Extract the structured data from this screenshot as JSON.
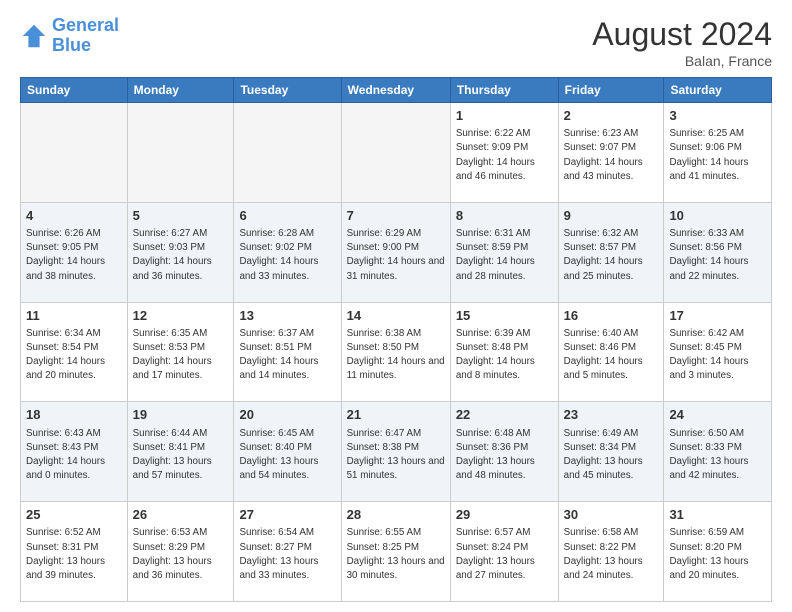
{
  "logo": {
    "line1": "General",
    "line2": "Blue"
  },
  "header": {
    "month": "August 2024",
    "location": "Balan, France"
  },
  "days_of_week": [
    "Sunday",
    "Monday",
    "Tuesday",
    "Wednesday",
    "Thursday",
    "Friday",
    "Saturday"
  ],
  "weeks": [
    [
      {
        "day": "",
        "info": ""
      },
      {
        "day": "",
        "info": ""
      },
      {
        "day": "",
        "info": ""
      },
      {
        "day": "",
        "info": ""
      },
      {
        "day": "1",
        "info": "Sunrise: 6:22 AM\nSunset: 9:09 PM\nDaylight: 14 hours\nand 46 minutes."
      },
      {
        "day": "2",
        "info": "Sunrise: 6:23 AM\nSunset: 9:07 PM\nDaylight: 14 hours\nand 43 minutes."
      },
      {
        "day": "3",
        "info": "Sunrise: 6:25 AM\nSunset: 9:06 PM\nDaylight: 14 hours\nand 41 minutes."
      }
    ],
    [
      {
        "day": "4",
        "info": "Sunrise: 6:26 AM\nSunset: 9:05 PM\nDaylight: 14 hours\nand 38 minutes."
      },
      {
        "day": "5",
        "info": "Sunrise: 6:27 AM\nSunset: 9:03 PM\nDaylight: 14 hours\nand 36 minutes."
      },
      {
        "day": "6",
        "info": "Sunrise: 6:28 AM\nSunset: 9:02 PM\nDaylight: 14 hours\nand 33 minutes."
      },
      {
        "day": "7",
        "info": "Sunrise: 6:29 AM\nSunset: 9:00 PM\nDaylight: 14 hours\nand 31 minutes."
      },
      {
        "day": "8",
        "info": "Sunrise: 6:31 AM\nSunset: 8:59 PM\nDaylight: 14 hours\nand 28 minutes."
      },
      {
        "day": "9",
        "info": "Sunrise: 6:32 AM\nSunset: 8:57 PM\nDaylight: 14 hours\nand 25 minutes."
      },
      {
        "day": "10",
        "info": "Sunrise: 6:33 AM\nSunset: 8:56 PM\nDaylight: 14 hours\nand 22 minutes."
      }
    ],
    [
      {
        "day": "11",
        "info": "Sunrise: 6:34 AM\nSunset: 8:54 PM\nDaylight: 14 hours\nand 20 minutes."
      },
      {
        "day": "12",
        "info": "Sunrise: 6:35 AM\nSunset: 8:53 PM\nDaylight: 14 hours\nand 17 minutes."
      },
      {
        "day": "13",
        "info": "Sunrise: 6:37 AM\nSunset: 8:51 PM\nDaylight: 14 hours\nand 14 minutes."
      },
      {
        "day": "14",
        "info": "Sunrise: 6:38 AM\nSunset: 8:50 PM\nDaylight: 14 hours\nand 11 minutes."
      },
      {
        "day": "15",
        "info": "Sunrise: 6:39 AM\nSunset: 8:48 PM\nDaylight: 14 hours\nand 8 minutes."
      },
      {
        "day": "16",
        "info": "Sunrise: 6:40 AM\nSunset: 8:46 PM\nDaylight: 14 hours\nand 5 minutes."
      },
      {
        "day": "17",
        "info": "Sunrise: 6:42 AM\nSunset: 8:45 PM\nDaylight: 14 hours\nand 3 minutes."
      }
    ],
    [
      {
        "day": "18",
        "info": "Sunrise: 6:43 AM\nSunset: 8:43 PM\nDaylight: 14 hours\nand 0 minutes."
      },
      {
        "day": "19",
        "info": "Sunrise: 6:44 AM\nSunset: 8:41 PM\nDaylight: 13 hours\nand 57 minutes."
      },
      {
        "day": "20",
        "info": "Sunrise: 6:45 AM\nSunset: 8:40 PM\nDaylight: 13 hours\nand 54 minutes."
      },
      {
        "day": "21",
        "info": "Sunrise: 6:47 AM\nSunset: 8:38 PM\nDaylight: 13 hours\nand 51 minutes."
      },
      {
        "day": "22",
        "info": "Sunrise: 6:48 AM\nSunset: 8:36 PM\nDaylight: 13 hours\nand 48 minutes."
      },
      {
        "day": "23",
        "info": "Sunrise: 6:49 AM\nSunset: 8:34 PM\nDaylight: 13 hours\nand 45 minutes."
      },
      {
        "day": "24",
        "info": "Sunrise: 6:50 AM\nSunset: 8:33 PM\nDaylight: 13 hours\nand 42 minutes."
      }
    ],
    [
      {
        "day": "25",
        "info": "Sunrise: 6:52 AM\nSunset: 8:31 PM\nDaylight: 13 hours\nand 39 minutes."
      },
      {
        "day": "26",
        "info": "Sunrise: 6:53 AM\nSunset: 8:29 PM\nDaylight: 13 hours\nand 36 minutes."
      },
      {
        "day": "27",
        "info": "Sunrise: 6:54 AM\nSunset: 8:27 PM\nDaylight: 13 hours\nand 33 minutes."
      },
      {
        "day": "28",
        "info": "Sunrise: 6:55 AM\nSunset: 8:25 PM\nDaylight: 13 hours\nand 30 minutes."
      },
      {
        "day": "29",
        "info": "Sunrise: 6:57 AM\nSunset: 8:24 PM\nDaylight: 13 hours\nand 27 minutes."
      },
      {
        "day": "30",
        "info": "Sunrise: 6:58 AM\nSunset: 8:22 PM\nDaylight: 13 hours\nand 24 minutes."
      },
      {
        "day": "31",
        "info": "Sunrise: 6:59 AM\nSunset: 8:20 PM\nDaylight: 13 hours\nand 20 minutes."
      }
    ]
  ]
}
